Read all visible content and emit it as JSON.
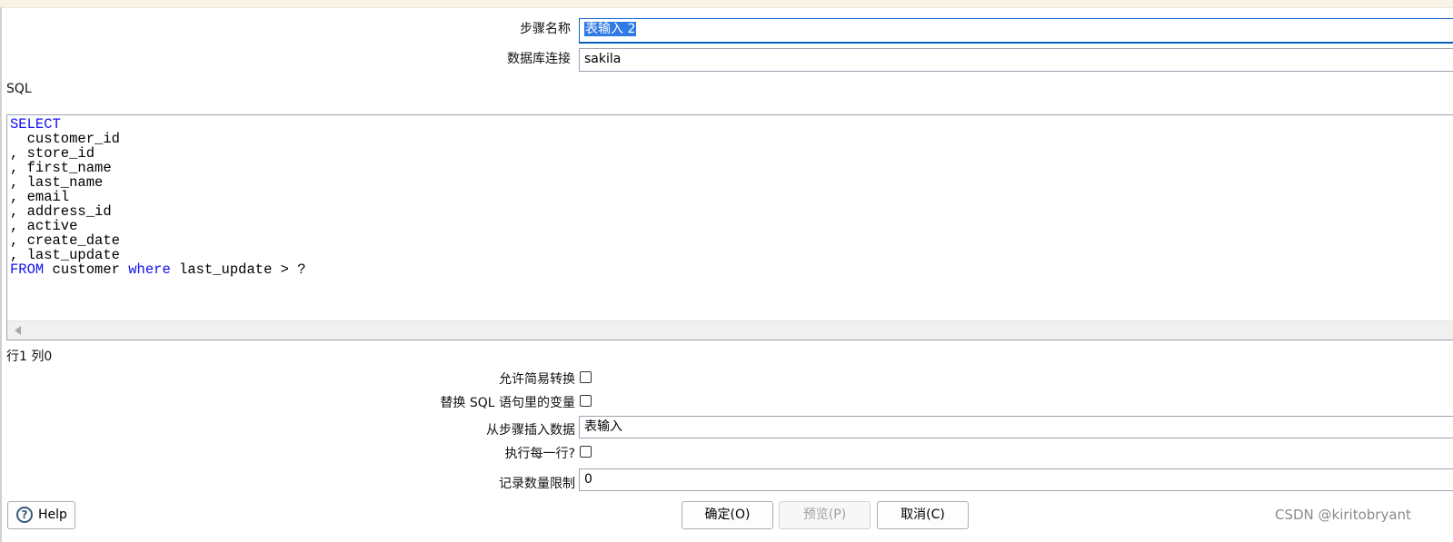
{
  "form": {
    "step_name_label": "步骤名称",
    "step_name_value": "表输入 2",
    "db_connection_label": "数据库连接",
    "db_connection_value": "sakila",
    "sql_label": "SQL"
  },
  "sql_editor": {
    "lines": [
      [
        {
          "t": "SELECT",
          "kw": true
        }
      ],
      [
        {
          "t": "  customer_id"
        }
      ],
      [
        {
          "t": ", store_id"
        }
      ],
      [
        {
          "t": ", first_name"
        }
      ],
      [
        {
          "t": ", last_name"
        }
      ],
      [
        {
          "t": ", email"
        }
      ],
      [
        {
          "t": ", address_id"
        }
      ],
      [
        {
          "t": ", active"
        }
      ],
      [
        {
          "t": ", create_date"
        }
      ],
      [
        {
          "t": ", last_update"
        }
      ],
      [
        {
          "t": "FROM",
          "kw": true
        },
        {
          "t": " customer "
        },
        {
          "t": "where",
          "kw": true
        },
        {
          "t": " last_update > ?"
        }
      ]
    ],
    "cursor_position": "行1 列0"
  },
  "options": {
    "lazy_conversion_label": "允许简易转换",
    "replace_variables_label": "替换 SQL 语句里的变量",
    "insert_data_from_step_label": "从步骤插入数据",
    "insert_data_from_step_value": "表输入",
    "execute_each_row_label": "执行每一行?",
    "limit_label": "记录数量限制",
    "limit_value": "0"
  },
  "buttons": {
    "help": "Help",
    "ok": "确定(O)",
    "preview": "预览(P)",
    "cancel": "取消(C)"
  },
  "watermark": "CSDN @kiritobryant",
  "colors": {
    "keyword": "#1010f0",
    "selection": "#2f7ae5",
    "focus_border": "#0f63c4"
  },
  "icons": {
    "help": "help-circle-icon",
    "scroll_left": "arrow-left-icon"
  }
}
